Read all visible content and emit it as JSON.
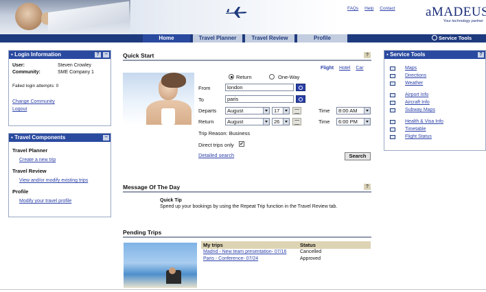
{
  "header": {
    "links": [
      "FAQs",
      "Help",
      "Contact"
    ],
    "logo_text": "aMADEUS",
    "logo_tagline": "Your technology partner"
  },
  "nav": {
    "tabs": [
      {
        "label": "Home",
        "active": true
      },
      {
        "label": "Travel Planner",
        "active": false
      },
      {
        "label": "Travel Review",
        "active": false
      },
      {
        "label": "Profile",
        "active": false
      }
    ],
    "service_tools": "Service Tools"
  },
  "login": {
    "title": "Login Information",
    "help": "?",
    "collapse": "−",
    "user_label": "User:",
    "user_value": "Steven Crowley",
    "community_label": "Community:",
    "community_value": "SME Company 1",
    "failed_attempts": "Failed login attempts: 0",
    "links": [
      "Change Community",
      "Logout"
    ]
  },
  "travel_components": {
    "title": "Travel Components",
    "collapse": "−",
    "groups": [
      {
        "heading": "Travel Planner",
        "link": "Create a new trip"
      },
      {
        "heading": "Travel Review",
        "link": "View and/or modify existing trips"
      },
      {
        "heading": "Profile",
        "link": "Modify your travel profile"
      }
    ]
  },
  "quick_start": {
    "title": "Quick Start",
    "help": "?",
    "modes": {
      "selected": "Flight",
      "others": [
        "Hotel",
        "Car"
      ]
    },
    "trip_type": {
      "return_label": "Return",
      "oneway_label": "One-Way",
      "selected": "Return"
    },
    "from_label": "From",
    "from_value": "london",
    "to_label": "To",
    "to_value": "paris",
    "departs_label": "Departs",
    "departs_month": "August",
    "departs_day": "17",
    "return_label": "Return",
    "return_month": "August",
    "return_day": "26",
    "time_label": "Time",
    "depart_time": "8:00 AM",
    "return_time": "6:00 PM",
    "trip_reason": "Trip Reason: Business",
    "direct_only_label": "Direct trips only",
    "direct_only_checked": true,
    "check_mark": "✔",
    "detailed_search": "Detailed search",
    "search_button": "Search"
  },
  "motd": {
    "title": "Message Of The Day",
    "help": "?",
    "tip_title": "Quick Tip",
    "tip_text": "Speed up your bookings by using the Repeat Trip function in the Travel Review tab."
  },
  "pending_trips": {
    "title": "Pending Trips",
    "columns": [
      "My trips",
      "Status"
    ],
    "rows": [
      {
        "trip": "Madrid - New team presentation- 07/16",
        "status": "Cancelled"
      },
      {
        "trip": "Paris - Conference- 07/24",
        "status": "Approved"
      }
    ]
  },
  "service_tools": {
    "title": "Service Tools",
    "help": "?",
    "groups": [
      [
        "Maps",
        "Directions",
        "Weather"
      ],
      [
        "Airport Info",
        "Aircraft Info",
        "Subway Maps"
      ],
      [
        "Health & Visa Info",
        "Timetable",
        "Flight Status"
      ]
    ]
  },
  "colors": {
    "nav_blue": "#1e3a7e",
    "active_tab": "#2a4aa0",
    "link": "#2a3fa8",
    "table_header": "#ddd4b4"
  }
}
